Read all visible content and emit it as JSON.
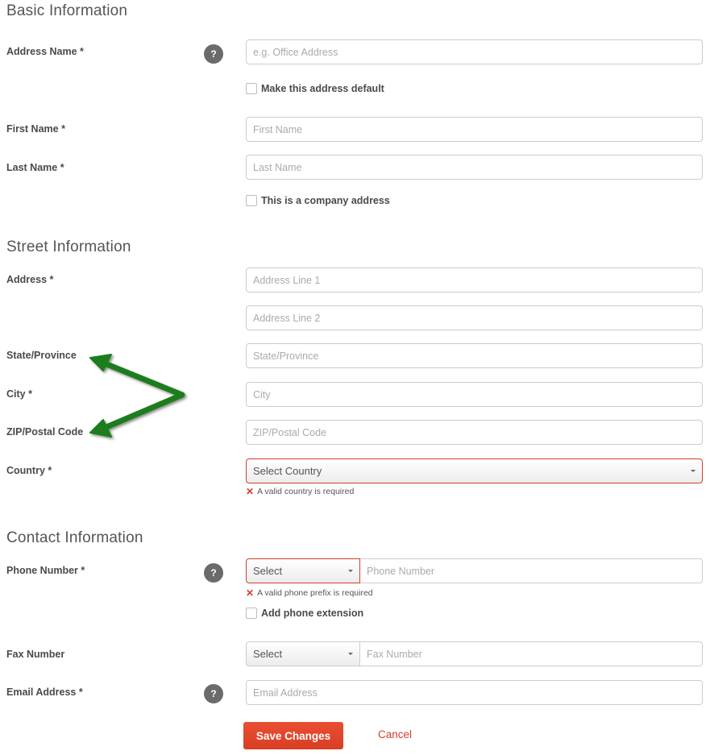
{
  "sections": {
    "basic": "Basic Information",
    "street": "Street Information",
    "contact": "Contact Information"
  },
  "basic": {
    "address_name": {
      "label": "Address Name *",
      "placeholder": "e.g. Office Address",
      "help": "?"
    },
    "default_checkbox": {
      "label": "Make this address default",
      "checked": false
    },
    "first_name": {
      "label": "First Name *",
      "placeholder": "First Name"
    },
    "last_name": {
      "label": "Last Name *",
      "placeholder": "Last Name"
    },
    "company_checkbox": {
      "label": "This is a company address",
      "checked": false
    }
  },
  "street": {
    "address": {
      "label": "Address *",
      "placeholder1": "Address Line 1",
      "placeholder2": "Address Line 2"
    },
    "state": {
      "label": "State/Province",
      "placeholder": "State/Province"
    },
    "city": {
      "label": "City *",
      "placeholder": "City"
    },
    "zip": {
      "label": "ZIP/Postal Code",
      "placeholder": "ZIP/Postal Code"
    },
    "country": {
      "label": "Country *",
      "selected": "Select Country",
      "error": "A valid country is required"
    }
  },
  "contact": {
    "phone": {
      "label": "Phone Number *",
      "help": "?",
      "prefix_selected": "Select",
      "placeholder": "Phone Number",
      "error": "A valid phone prefix is required"
    },
    "extension_checkbox": {
      "label": "Add phone extension",
      "checked": false
    },
    "fax": {
      "label": "Fax Number",
      "prefix_selected": "Select",
      "placeholder": "Fax Number"
    },
    "email": {
      "label": "Email Address *",
      "help": "?",
      "placeholder": "Email Address"
    }
  },
  "actions": {
    "save": "Save Changes",
    "cancel": "Cancel"
  },
  "annotation": {
    "color": "#1e7d1e",
    "description": "green arrows pointing to State/Province and ZIP/Postal Code"
  },
  "colors": {
    "error": "#d0402a",
    "primary_button": "#e1472c"
  },
  "icons": {
    "error": "✕"
  }
}
